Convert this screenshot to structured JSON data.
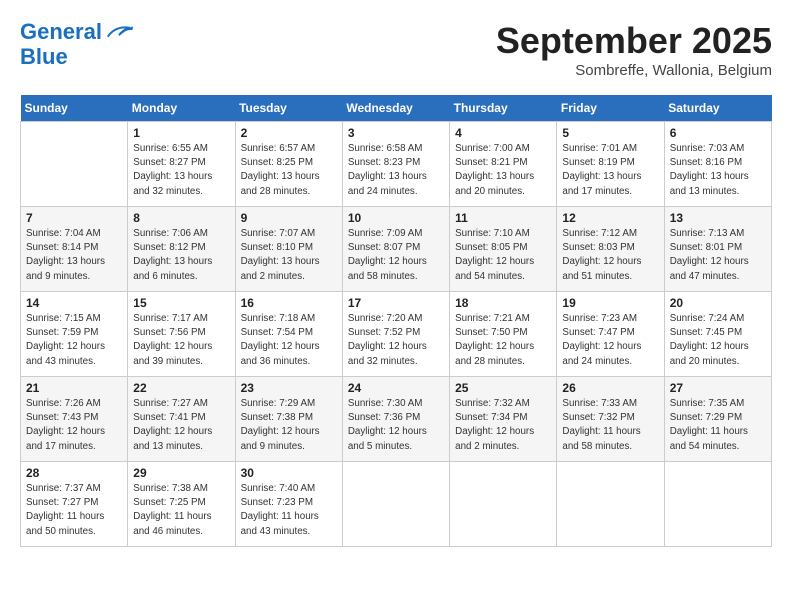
{
  "header": {
    "logo_line1": "General",
    "logo_line2": "Blue",
    "month_title": "September 2025",
    "subtitle": "Sombreffe, Wallonia, Belgium"
  },
  "days_of_week": [
    "Sunday",
    "Monday",
    "Tuesday",
    "Wednesday",
    "Thursday",
    "Friday",
    "Saturday"
  ],
  "weeks": [
    [
      {
        "day": "",
        "info": ""
      },
      {
        "day": "1",
        "info": "Sunrise: 6:55 AM\nSunset: 8:27 PM\nDaylight: 13 hours\nand 32 minutes."
      },
      {
        "day": "2",
        "info": "Sunrise: 6:57 AM\nSunset: 8:25 PM\nDaylight: 13 hours\nand 28 minutes."
      },
      {
        "day": "3",
        "info": "Sunrise: 6:58 AM\nSunset: 8:23 PM\nDaylight: 13 hours\nand 24 minutes."
      },
      {
        "day": "4",
        "info": "Sunrise: 7:00 AM\nSunset: 8:21 PM\nDaylight: 13 hours\nand 20 minutes."
      },
      {
        "day": "5",
        "info": "Sunrise: 7:01 AM\nSunset: 8:19 PM\nDaylight: 13 hours\nand 17 minutes."
      },
      {
        "day": "6",
        "info": "Sunrise: 7:03 AM\nSunset: 8:16 PM\nDaylight: 13 hours\nand 13 minutes."
      }
    ],
    [
      {
        "day": "7",
        "info": "Sunrise: 7:04 AM\nSunset: 8:14 PM\nDaylight: 13 hours\nand 9 minutes."
      },
      {
        "day": "8",
        "info": "Sunrise: 7:06 AM\nSunset: 8:12 PM\nDaylight: 13 hours\nand 6 minutes."
      },
      {
        "day": "9",
        "info": "Sunrise: 7:07 AM\nSunset: 8:10 PM\nDaylight: 13 hours\nand 2 minutes."
      },
      {
        "day": "10",
        "info": "Sunrise: 7:09 AM\nSunset: 8:07 PM\nDaylight: 12 hours\nand 58 minutes."
      },
      {
        "day": "11",
        "info": "Sunrise: 7:10 AM\nSunset: 8:05 PM\nDaylight: 12 hours\nand 54 minutes."
      },
      {
        "day": "12",
        "info": "Sunrise: 7:12 AM\nSunset: 8:03 PM\nDaylight: 12 hours\nand 51 minutes."
      },
      {
        "day": "13",
        "info": "Sunrise: 7:13 AM\nSunset: 8:01 PM\nDaylight: 12 hours\nand 47 minutes."
      }
    ],
    [
      {
        "day": "14",
        "info": "Sunrise: 7:15 AM\nSunset: 7:59 PM\nDaylight: 12 hours\nand 43 minutes."
      },
      {
        "day": "15",
        "info": "Sunrise: 7:17 AM\nSunset: 7:56 PM\nDaylight: 12 hours\nand 39 minutes."
      },
      {
        "day": "16",
        "info": "Sunrise: 7:18 AM\nSunset: 7:54 PM\nDaylight: 12 hours\nand 36 minutes."
      },
      {
        "day": "17",
        "info": "Sunrise: 7:20 AM\nSunset: 7:52 PM\nDaylight: 12 hours\nand 32 minutes."
      },
      {
        "day": "18",
        "info": "Sunrise: 7:21 AM\nSunset: 7:50 PM\nDaylight: 12 hours\nand 28 minutes."
      },
      {
        "day": "19",
        "info": "Sunrise: 7:23 AM\nSunset: 7:47 PM\nDaylight: 12 hours\nand 24 minutes."
      },
      {
        "day": "20",
        "info": "Sunrise: 7:24 AM\nSunset: 7:45 PM\nDaylight: 12 hours\nand 20 minutes."
      }
    ],
    [
      {
        "day": "21",
        "info": "Sunrise: 7:26 AM\nSunset: 7:43 PM\nDaylight: 12 hours\nand 17 minutes."
      },
      {
        "day": "22",
        "info": "Sunrise: 7:27 AM\nSunset: 7:41 PM\nDaylight: 12 hours\nand 13 minutes."
      },
      {
        "day": "23",
        "info": "Sunrise: 7:29 AM\nSunset: 7:38 PM\nDaylight: 12 hours\nand 9 minutes."
      },
      {
        "day": "24",
        "info": "Sunrise: 7:30 AM\nSunset: 7:36 PM\nDaylight: 12 hours\nand 5 minutes."
      },
      {
        "day": "25",
        "info": "Sunrise: 7:32 AM\nSunset: 7:34 PM\nDaylight: 12 hours\nand 2 minutes."
      },
      {
        "day": "26",
        "info": "Sunrise: 7:33 AM\nSunset: 7:32 PM\nDaylight: 11 hours\nand 58 minutes."
      },
      {
        "day": "27",
        "info": "Sunrise: 7:35 AM\nSunset: 7:29 PM\nDaylight: 11 hours\nand 54 minutes."
      }
    ],
    [
      {
        "day": "28",
        "info": "Sunrise: 7:37 AM\nSunset: 7:27 PM\nDaylight: 11 hours\nand 50 minutes."
      },
      {
        "day": "29",
        "info": "Sunrise: 7:38 AM\nSunset: 7:25 PM\nDaylight: 11 hours\nand 46 minutes."
      },
      {
        "day": "30",
        "info": "Sunrise: 7:40 AM\nSunset: 7:23 PM\nDaylight: 11 hours\nand 43 minutes."
      },
      {
        "day": "",
        "info": ""
      },
      {
        "day": "",
        "info": ""
      },
      {
        "day": "",
        "info": ""
      },
      {
        "day": "",
        "info": ""
      }
    ]
  ]
}
